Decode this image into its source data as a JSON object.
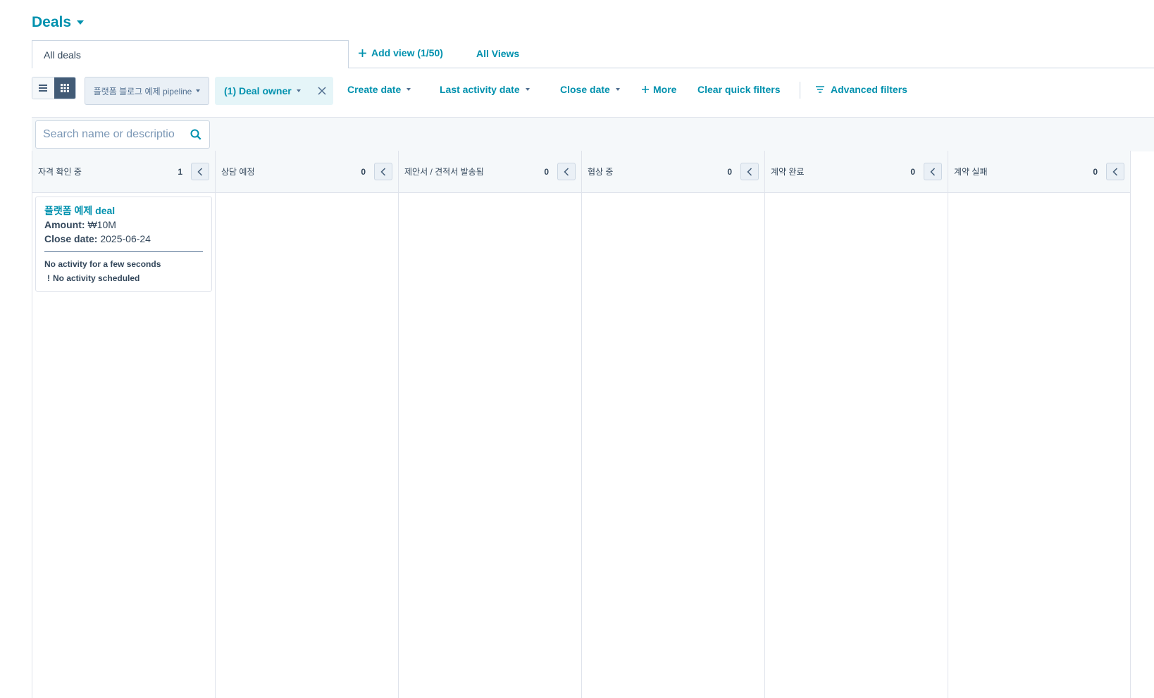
{
  "header": {
    "title": "Deals"
  },
  "views": {
    "active_tab": "All deals",
    "add_view": "Add view (1/50)",
    "all_views": "All Views"
  },
  "toolbar": {
    "pipeline": "플랫폼 블로그 예제 pipeline",
    "deal_owner": "(1) Deal owner",
    "create_date": "Create date",
    "last_activity_date": "Last activity date",
    "close_date": "Close date",
    "more": "More",
    "clear_quick_filters": "Clear quick filters",
    "advanced_filters": "Advanced filters"
  },
  "search": {
    "placeholder": "Search name or descriptio"
  },
  "stages": [
    {
      "label": "자격 확인 중",
      "count": "1"
    },
    {
      "label": "상담 예정",
      "count": "0"
    },
    {
      "label": "제안서 / 견적서 발송됨",
      "count": "0"
    },
    {
      "label": "협상 중",
      "count": "0"
    },
    {
      "label": "계약 완료",
      "count": "0"
    },
    {
      "label": "계약 실패",
      "count": "0"
    }
  ],
  "card": {
    "name": "플랫폼 예제 deal",
    "amount_label": "Amount:",
    "amount_value": "₩10M",
    "close_label": "Close date:",
    "close_value": "2025-06-24",
    "activity": "No activity for a few seconds",
    "warn_icon": "!",
    "scheduled": "No activity scheduled"
  },
  "colors": {
    "accent": "#0091ae",
    "text": "#33475b",
    "header_bg": "#f5f8fa",
    "toggle_active": "#425b76"
  }
}
